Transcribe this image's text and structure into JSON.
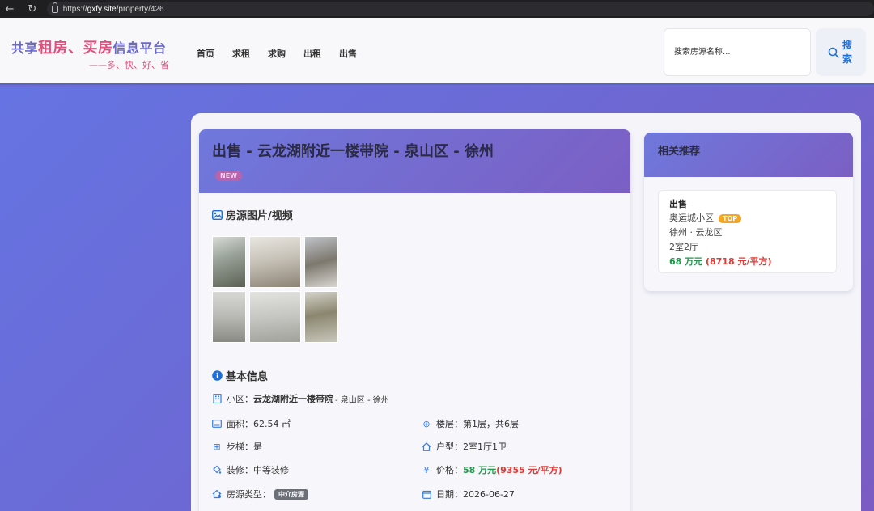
{
  "browser": {
    "url_prefix": "https://",
    "url_host": "gxfy.site",
    "url_path": "/property/426"
  },
  "header": {
    "logo_part1": "共享",
    "logo_part2": "租房、买房",
    "logo_part3": "信息平台",
    "slogan": "——多、快、好、省",
    "nav": [
      "首页",
      "求租",
      "求购",
      "出租",
      "出售"
    ],
    "search_placeholder": "搜索房源名称...",
    "search_button": "搜索"
  },
  "detail": {
    "title": "出售 - 云龙湖附近一楼带院 - 泉山区 - 徐州",
    "badge": "NEW",
    "media_section": "房源图片/视频",
    "basic_section": "基本信息",
    "community_label": "小区：",
    "community_name": "云龙湖附近一楼带院",
    "community_location": " - 泉山区 - 徐州",
    "area": "面积：62.54 ㎡",
    "floor": "楼层：第1层，共6层",
    "stairs": "步梯：是",
    "layout": "户型：2室1厅1卫",
    "decoration": "装修：中等装修",
    "price_label": "价格：",
    "price_total": "58 万元",
    "price_unit": " (9355 元/平方)",
    "source_type_label": "房源类型：",
    "source_type_tag": "中介房源",
    "date": "日期：2026-06-27"
  },
  "recommend": {
    "title": "相关推荐",
    "item": {
      "type": "出售",
      "community": "奥运城小区",
      "badge": "TOP",
      "location": "徐州 · 云龙区",
      "layout": "2室2厅",
      "price_total": "68 万元",
      "price_unit": " (8718 元/平方)"
    }
  },
  "colors": {
    "accent_blue": "#1f6fd6",
    "price_green": "#1e9a4a",
    "price_red": "#e53935",
    "header_gradient_start": "#6f78dc",
    "header_gradient_end": "#7b5fc4"
  }
}
